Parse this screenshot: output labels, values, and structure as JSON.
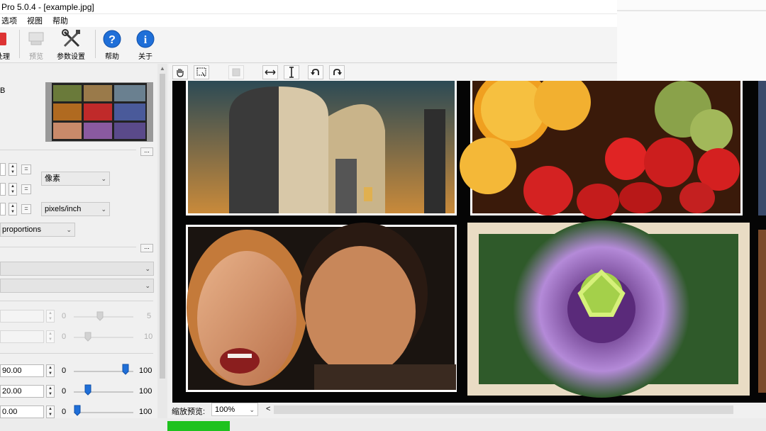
{
  "window": {
    "title": "Pro 5.0.4 - [example.jpg]"
  },
  "menu": {
    "items": [
      {
        "label": "选项"
      },
      {
        "label": "视图"
      },
      {
        "label": "帮助"
      }
    ]
  },
  "toolbar": {
    "buttons": [
      {
        "label": "处理",
        "icon": "process-icon",
        "enabled": true
      },
      {
        "label": "预览",
        "icon": "preview-icon",
        "enabled": false
      },
      {
        "label": "参数设置",
        "icon": "settings-icon",
        "enabled": true
      },
      {
        "label": "帮助",
        "icon": "help-icon",
        "enabled": true
      },
      {
        "label": "关于",
        "icon": "about-icon",
        "enabled": true
      }
    ]
  },
  "left_panel": {
    "color_mode_fragment": "B",
    "unit_select": "像素",
    "resolution_unit_select": "pixels/inch",
    "proportion_select": "proportions",
    "sliders": [
      {
        "value_text": "",
        "min_label": "0",
        "max_label": "5",
        "level": 0.42,
        "enabled": false
      },
      {
        "value_text": "",
        "min_label": "0",
        "max_label": "10",
        "level": 0.2,
        "enabled": false
      },
      {
        "value_text": "90.00",
        "min_label": "0",
        "max_label": "100",
        "level": 0.9,
        "enabled": true
      },
      {
        "value_text": "20.00",
        "min_label": "0",
        "max_label": "100",
        "level": 0.2,
        "enabled": true
      },
      {
        "value_text": "0.00",
        "min_label": "0",
        "max_label": "100",
        "level": 0.0,
        "enabled": true
      }
    ]
  },
  "preview_toolbar": {
    "buttons": [
      {
        "icon": "hand-icon"
      },
      {
        "icon": "zoom-select-icon"
      },
      {
        "icon": "crop-icon"
      },
      {
        "icon": "fit-width-icon"
      },
      {
        "icon": "fit-height-icon"
      },
      {
        "icon": "rotate-left-icon"
      },
      {
        "icon": "rotate-right-icon"
      }
    ]
  },
  "statusbar": {
    "zoom_label": "缩放预览:",
    "zoom_value": "100%"
  },
  "colors": {
    "progress": "#1ec21e",
    "help_blue": "#1f6fd8"
  }
}
